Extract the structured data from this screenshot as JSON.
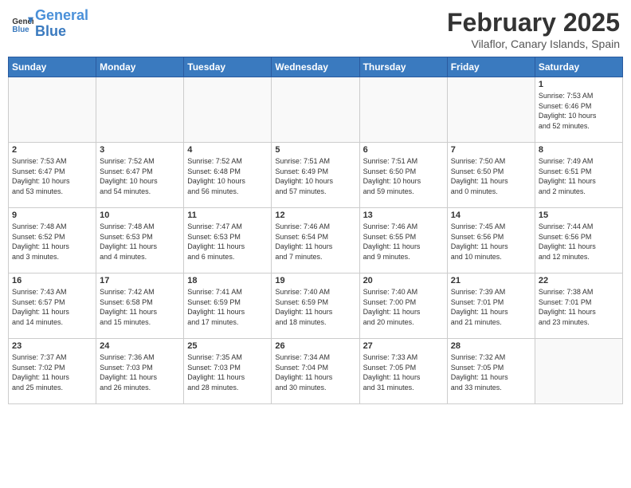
{
  "header": {
    "logo_line1": "General",
    "logo_line2": "Blue",
    "month_title": "February 2025",
    "subtitle": "Vilaflor, Canary Islands, Spain"
  },
  "weekdays": [
    "Sunday",
    "Monday",
    "Tuesday",
    "Wednesday",
    "Thursday",
    "Friday",
    "Saturday"
  ],
  "weeks": [
    [
      {
        "day": "",
        "info": ""
      },
      {
        "day": "",
        "info": ""
      },
      {
        "day": "",
        "info": ""
      },
      {
        "day": "",
        "info": ""
      },
      {
        "day": "",
        "info": ""
      },
      {
        "day": "",
        "info": ""
      },
      {
        "day": "1",
        "info": "Sunrise: 7:53 AM\nSunset: 6:46 PM\nDaylight: 10 hours\nand 52 minutes."
      }
    ],
    [
      {
        "day": "2",
        "info": "Sunrise: 7:53 AM\nSunset: 6:47 PM\nDaylight: 10 hours\nand 53 minutes."
      },
      {
        "day": "3",
        "info": "Sunrise: 7:52 AM\nSunset: 6:47 PM\nDaylight: 10 hours\nand 54 minutes."
      },
      {
        "day": "4",
        "info": "Sunrise: 7:52 AM\nSunset: 6:48 PM\nDaylight: 10 hours\nand 56 minutes."
      },
      {
        "day": "5",
        "info": "Sunrise: 7:51 AM\nSunset: 6:49 PM\nDaylight: 10 hours\nand 57 minutes."
      },
      {
        "day": "6",
        "info": "Sunrise: 7:51 AM\nSunset: 6:50 PM\nDaylight: 10 hours\nand 59 minutes."
      },
      {
        "day": "7",
        "info": "Sunrise: 7:50 AM\nSunset: 6:50 PM\nDaylight: 11 hours\nand 0 minutes."
      },
      {
        "day": "8",
        "info": "Sunrise: 7:49 AM\nSunset: 6:51 PM\nDaylight: 11 hours\nand 2 minutes."
      }
    ],
    [
      {
        "day": "9",
        "info": "Sunrise: 7:48 AM\nSunset: 6:52 PM\nDaylight: 11 hours\nand 3 minutes."
      },
      {
        "day": "10",
        "info": "Sunrise: 7:48 AM\nSunset: 6:53 PM\nDaylight: 11 hours\nand 4 minutes."
      },
      {
        "day": "11",
        "info": "Sunrise: 7:47 AM\nSunset: 6:53 PM\nDaylight: 11 hours\nand 6 minutes."
      },
      {
        "day": "12",
        "info": "Sunrise: 7:46 AM\nSunset: 6:54 PM\nDaylight: 11 hours\nand 7 minutes."
      },
      {
        "day": "13",
        "info": "Sunrise: 7:46 AM\nSunset: 6:55 PM\nDaylight: 11 hours\nand 9 minutes."
      },
      {
        "day": "14",
        "info": "Sunrise: 7:45 AM\nSunset: 6:56 PM\nDaylight: 11 hours\nand 10 minutes."
      },
      {
        "day": "15",
        "info": "Sunrise: 7:44 AM\nSunset: 6:56 PM\nDaylight: 11 hours\nand 12 minutes."
      }
    ],
    [
      {
        "day": "16",
        "info": "Sunrise: 7:43 AM\nSunset: 6:57 PM\nDaylight: 11 hours\nand 14 minutes."
      },
      {
        "day": "17",
        "info": "Sunrise: 7:42 AM\nSunset: 6:58 PM\nDaylight: 11 hours\nand 15 minutes."
      },
      {
        "day": "18",
        "info": "Sunrise: 7:41 AM\nSunset: 6:59 PM\nDaylight: 11 hours\nand 17 minutes."
      },
      {
        "day": "19",
        "info": "Sunrise: 7:40 AM\nSunset: 6:59 PM\nDaylight: 11 hours\nand 18 minutes."
      },
      {
        "day": "20",
        "info": "Sunrise: 7:40 AM\nSunset: 7:00 PM\nDaylight: 11 hours\nand 20 minutes."
      },
      {
        "day": "21",
        "info": "Sunrise: 7:39 AM\nSunset: 7:01 PM\nDaylight: 11 hours\nand 21 minutes."
      },
      {
        "day": "22",
        "info": "Sunrise: 7:38 AM\nSunset: 7:01 PM\nDaylight: 11 hours\nand 23 minutes."
      }
    ],
    [
      {
        "day": "23",
        "info": "Sunrise: 7:37 AM\nSunset: 7:02 PM\nDaylight: 11 hours\nand 25 minutes."
      },
      {
        "day": "24",
        "info": "Sunrise: 7:36 AM\nSunset: 7:03 PM\nDaylight: 11 hours\nand 26 minutes."
      },
      {
        "day": "25",
        "info": "Sunrise: 7:35 AM\nSunset: 7:03 PM\nDaylight: 11 hours\nand 28 minutes."
      },
      {
        "day": "26",
        "info": "Sunrise: 7:34 AM\nSunset: 7:04 PM\nDaylight: 11 hours\nand 30 minutes."
      },
      {
        "day": "27",
        "info": "Sunrise: 7:33 AM\nSunset: 7:05 PM\nDaylight: 11 hours\nand 31 minutes."
      },
      {
        "day": "28",
        "info": "Sunrise: 7:32 AM\nSunset: 7:05 PM\nDaylight: 11 hours\nand 33 minutes."
      },
      {
        "day": "",
        "info": ""
      }
    ]
  ]
}
